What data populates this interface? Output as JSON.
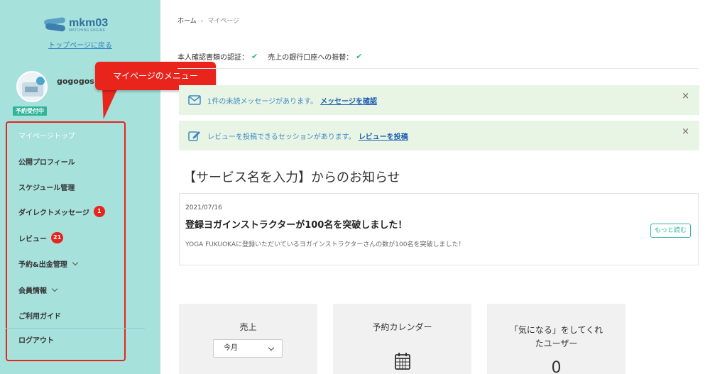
{
  "sidebar": {
    "logo_name": "mkm03",
    "logo_sub": "MATCHING ENGINE",
    "top_link": "トップページに戻る",
    "username": "gogogos",
    "status": "予約受付中",
    "menu": [
      {
        "label": "マイページトップ"
      },
      {
        "label": "公開プロフィール"
      },
      {
        "label": "スケジュール管理"
      },
      {
        "label": "ダイレクトメッセージ",
        "badge": "1"
      },
      {
        "label": "レビュー",
        "badge": "21"
      },
      {
        "label": "予約&出金管理"
      },
      {
        "label": "会員情報"
      },
      {
        "label": "ご利用ガイド"
      },
      {
        "label": "ログアウト"
      }
    ]
  },
  "callout": "マイページのメニュー",
  "breadcrumb": {
    "home": "ホーム",
    "sep": "›",
    "current": "マイページ"
  },
  "verification": {
    "id_label": "本人確認書類の認証：",
    "bank_label": "売上の銀行口座への振替：",
    "check": "✔"
  },
  "alerts": [
    {
      "text": "1件の未読メッセージがあります。",
      "link": "メッセージを確認",
      "close": "×"
    },
    {
      "text": "レビューを投稿できるセッションがあります。",
      "link": "レビューを投稿",
      "close": "×"
    }
  ],
  "news_section_title": "【サービス名を入力】からのお知らせ",
  "news": {
    "date": "2021/07/16",
    "title": "登録ヨガインストラクターが100名を突破しました！",
    "body": "YOGA FUKUOKAに登録いただいているヨガインストラクターさんの数が100名を突破しました！",
    "more": "もっと読む"
  },
  "cards": {
    "sales": {
      "title": "売上",
      "select_value": "今月"
    },
    "calendar": {
      "title": "予約カレンダー"
    },
    "favorites": {
      "title_line1": "「気になる」をしてくれ",
      "title_line2": "たユーザー",
      "count": "0"
    }
  },
  "colors": {
    "sidebar_bg": "#a7e1dc",
    "accent_red": "#e8241d",
    "accent_green": "#30b59b",
    "alert_bg": "#e9f5e4",
    "link_blue": "#2060b0"
  }
}
